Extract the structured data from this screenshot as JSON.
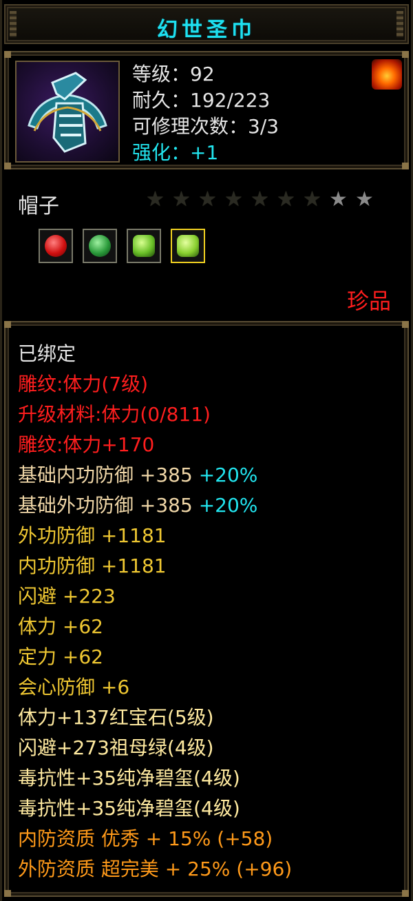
{
  "title": "幻世圣巾",
  "header": {
    "level": "等级：92",
    "durability": "耐久：192/223",
    "repairs": "可修理次数：3/3",
    "enhance": "强化：+1"
  },
  "item_type": "帽子",
  "stars": {
    "total": 9,
    "dim": 7,
    "lit": 2
  },
  "gems": [
    {
      "name": "ruby-gem",
      "color": "#e01818"
    },
    {
      "name": "emerald-gem",
      "color": "#2a9a3a"
    },
    {
      "name": "jade-gem",
      "color": "#6ac028"
    },
    {
      "name": "jade-gem",
      "color": "#8ad030"
    }
  ],
  "rarity": "珍品",
  "attributes": [
    {
      "text": "已绑定",
      "color": "white"
    },
    {
      "text": "雕纹:体力(7级)",
      "color": "red"
    },
    {
      "text": "升级材料:体力(0/811)",
      "color": "red"
    },
    {
      "text": "雕纹:体力+170",
      "color": "red"
    },
    {
      "text": "基础内功防御 +385 ",
      "pct": "+20%",
      "color": "beige"
    },
    {
      "text": "基础外功防御 +385 ",
      "pct": "+20%",
      "color": "beige"
    },
    {
      "text": "外功防御 +1181",
      "color": "gold"
    },
    {
      "text": "内功防御 +1181",
      "color": "gold"
    },
    {
      "text": "闪避 +223",
      "color": "gold"
    },
    {
      "text": "体力 +62",
      "color": "gold"
    },
    {
      "text": "定力 +62",
      "color": "gold"
    },
    {
      "text": "会心防御 +6",
      "color": "gold"
    },
    {
      "text": "体力+137红宝石(5级)",
      "color": "yellow"
    },
    {
      "text": "闪避+273祖母绿(4级)",
      "color": "yellow"
    },
    {
      "text": "毒抗性+35纯净碧玺(4级)",
      "color": "yellow"
    },
    {
      "text": "毒抗性+35纯净碧玺(4级)",
      "color": "yellow"
    },
    {
      "text": "内防资质 优秀 + 15% (+58)",
      "color": "orange"
    },
    {
      "text": "外防资质 超完美 + 25% (+96)",
      "color": "orange"
    }
  ]
}
